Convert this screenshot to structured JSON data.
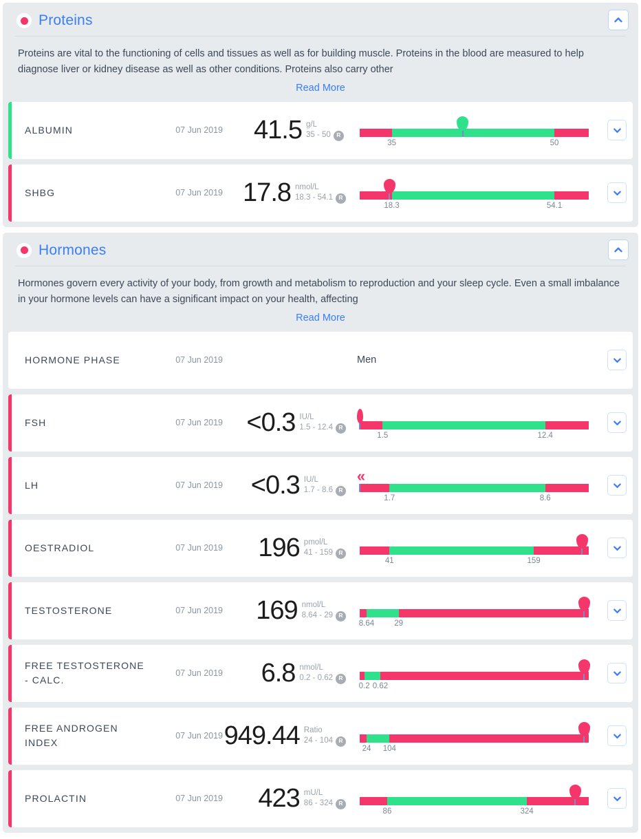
{
  "colors": {
    "accent_blue": "#3c7ef3",
    "abnormal_pink": "#f5366a",
    "normal_green": "#2fe18b",
    "section_bg": "#e7ebee",
    "row_bg": "#ffffff",
    "muted_text": "#9aa3ad"
  },
  "sections": [
    {
      "title": "Proteins",
      "dot_icon": "status-dot-icon",
      "collapse_icon": "chevron-up-icon",
      "description": "Proteins are vital to the functioning of cells and tissues as well as for building muscle. Proteins in the blood are measured to help diagnose liver or kidney disease as well as other conditions. Proteins also carry other",
      "read_more": "Read More",
      "rows": [
        {
          "name": "ALBUMIN",
          "date": "07 Jun 2019",
          "value": "41.5",
          "unit": "g/L",
          "range": "35 - 50",
          "badge": "R",
          "status": "normal",
          "expand_icon": "chevron-down-icon",
          "gauge": {
            "low_pct": 14,
            "high_pct": 85,
            "low_label": "35",
            "high_label": "50",
            "marker_pct": 45,
            "marker_color": "green",
            "marker_type": "pin"
          }
        },
        {
          "name": "SHBG",
          "date": "07 Jun 2019",
          "value": "17.8",
          "unit": "nmol/L",
          "range": "18.3 - 54.1",
          "badge": "R",
          "status": "abnormal",
          "expand_icon": "chevron-down-icon",
          "gauge": {
            "low_pct": 14,
            "high_pct": 85,
            "low_label": "18.3",
            "high_label": "54.1",
            "marker_pct": 13,
            "marker_color": "red",
            "marker_type": "pin"
          }
        }
      ]
    },
    {
      "title": "Hormones",
      "dot_icon": "status-dot-icon",
      "collapse_icon": "chevron-up-icon",
      "description": "Hormones govern every activity of your body, from growth and metabolism to reproduction and your sleep cycle. Even a small imbalance in your hormone levels can have a significant impact on your health, affecting",
      "read_more": "Read More",
      "rows": [
        {
          "name": "HORMONE PHASE",
          "date": "07 Jun 2019",
          "text_value": "Men",
          "status": "none",
          "expand_icon": "chevron-down-icon"
        },
        {
          "name": "FSH",
          "date": "07 Jun 2019",
          "value": "<0.3",
          "unit": "IU/L",
          "range": "1.5 - 12.4",
          "badge": "R",
          "status": "abnormal",
          "expand_icon": "chevron-down-icon",
          "gauge": {
            "low_pct": 10,
            "high_pct": 81,
            "low_label": "1.5",
            "high_label": "12.4",
            "marker_pct": 0,
            "marker_color": "red",
            "marker_type": "narrow"
          }
        },
        {
          "name": "LH",
          "date": "07 Jun 2019",
          "value": "<0.3",
          "unit": "IU/L",
          "range": "1.7 - 8.6",
          "badge": "R",
          "status": "abnormal",
          "expand_icon": "chevron-down-icon",
          "gauge": {
            "low_pct": 13,
            "high_pct": 81,
            "low_label": "1.7",
            "high_label": "8.6",
            "marker_pct": 0,
            "marker_color": "red",
            "marker_type": "chevrons",
            "marker_glyph": "«"
          }
        },
        {
          "name": "OESTRADIOL",
          "date": "07 Jun 2019",
          "value": "196",
          "unit": "pmol/L",
          "range": "41 - 159",
          "badge": "R",
          "status": "abnormal",
          "expand_icon": "chevron-down-icon",
          "gauge": {
            "low_pct": 13,
            "high_pct": 76,
            "low_label": "41",
            "high_label": "159",
            "marker_pct": 97,
            "marker_color": "red",
            "marker_type": "pin"
          }
        },
        {
          "name": "TESTOSTERONE",
          "date": "07 Jun 2019",
          "value": "169",
          "unit": "nmol/L",
          "range": "8.64 - 29",
          "badge": "R",
          "status": "abnormal",
          "expand_icon": "chevron-down-icon",
          "gauge": {
            "low_pct": 3,
            "high_pct": 17,
            "low_label": "8.64",
            "high_label": "29",
            "marker_pct": 98,
            "marker_color": "red",
            "marker_type": "pin"
          }
        },
        {
          "name": "FREE TESTOSTERONE - CALC.",
          "date": "07 Jun 2019",
          "value": "6.8",
          "unit": "nmol/L",
          "range": "0.2 - 0.62",
          "badge": "R",
          "status": "abnormal",
          "expand_icon": "chevron-down-icon",
          "gauge": {
            "low_pct": 2,
            "high_pct": 9,
            "low_label": "0.2",
            "high_label": "0.62",
            "marker_pct": 98,
            "marker_color": "red",
            "marker_type": "pin"
          }
        },
        {
          "name": "FREE ANDROGEN INDEX",
          "date": "07 Jun 2019",
          "value": "949.44",
          "unit": "Ratio",
          "range": "24 - 104",
          "badge": "R",
          "status": "abnormal",
          "expand_icon": "chevron-down-icon",
          "gauge": {
            "low_pct": 3,
            "high_pct": 13,
            "low_label": "24",
            "high_label": "104",
            "marker_pct": 98,
            "marker_color": "red",
            "marker_type": "pin"
          }
        },
        {
          "name": "PROLACTIN",
          "date": "07 Jun 2019",
          "value": "423",
          "unit": "mU/L",
          "range": "86 - 324",
          "badge": "R",
          "status": "abnormal",
          "expand_icon": "chevron-down-icon",
          "gauge": {
            "low_pct": 12,
            "high_pct": 73,
            "low_label": "86",
            "high_label": "324",
            "marker_pct": 94,
            "marker_color": "red",
            "marker_type": "pin"
          }
        }
      ]
    }
  ]
}
